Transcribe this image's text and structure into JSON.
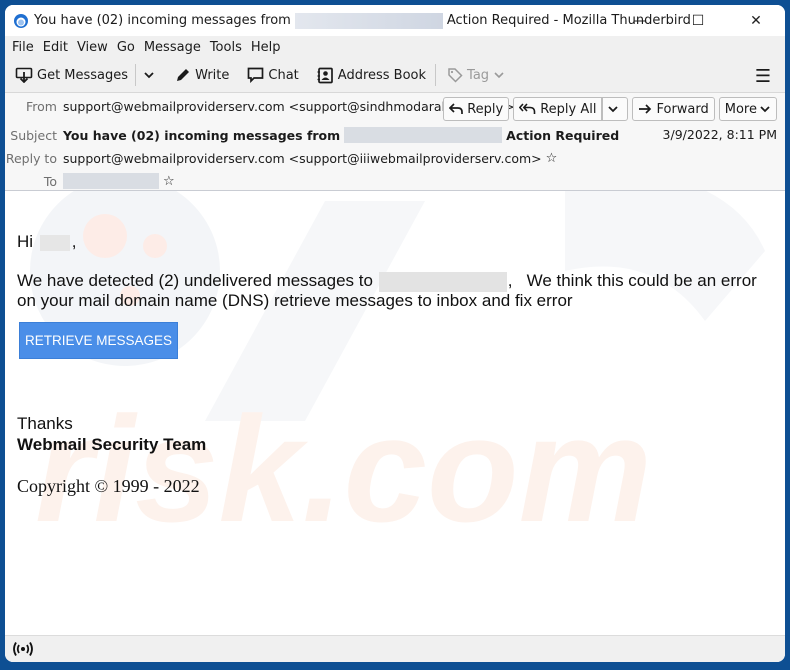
{
  "window": {
    "title_prefix": "You have (02) incoming messages from",
    "title_suffix": "Action Required - Mozilla Thunderbird",
    "controls": {
      "minimize": "—",
      "maximize": "☐",
      "close": "✕"
    }
  },
  "menubar": {
    "items": [
      "File",
      "Edit",
      "View",
      "Go",
      "Message",
      "Tools",
      "Help"
    ]
  },
  "toolbar": {
    "get_messages": "Get Messages",
    "write": "Write",
    "chat": "Chat",
    "address_book": "Address Book",
    "tag": "Tag",
    "menu_icon": "☰"
  },
  "header": {
    "labels": {
      "from": "From",
      "subject": "Subject",
      "reply_to": "Reply to",
      "to": "To"
    },
    "from_value": "support@webmailproviderserv.com <support@sindhmodarabaltd.com>",
    "subject_prefix": "You have (02) incoming messages from",
    "subject_suffix": "Action Required",
    "reply_to_value": "support@webmailproviderserv.com <support@iiiwebmailproviderserv.com>",
    "date": "3/9/2022, 8:11 PM",
    "buttons": {
      "reply": "Reply",
      "reply_all": "Reply All",
      "forward": "Forward",
      "more": "More"
    },
    "star": "☆"
  },
  "message": {
    "greeting_prefix": "Hi",
    "greeting_suffix": ",",
    "line1_prefix": "We have detected (2) undelivered messages to",
    "line1_suffix": ",   We think this could be an error",
    "line2": "on your mail domain name (DNS) retrieve messages to inbox and fix error",
    "button": "RETRIEVE MESSAGES",
    "thanks": "Thanks",
    "signature": "Webmail Security Team",
    "copyright": "Copyright © 1999 - 2022",
    "accent_color": "#4a8ee8"
  },
  "statusbar": {
    "activity_icon": "((•))"
  }
}
